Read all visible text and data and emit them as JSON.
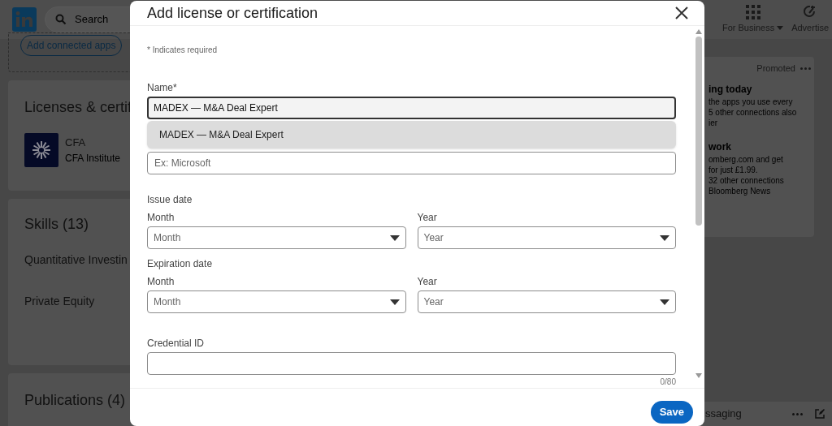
{
  "top_nav": {
    "search_placeholder": "Search",
    "items": [
      {
        "kind": "grid",
        "label": "For Business"
      },
      {
        "kind": "advertise",
        "label": "Advertise"
      }
    ]
  },
  "left_column": {
    "connected_apps_button": "Add connected apps",
    "licenses": {
      "title": "Licenses & certif",
      "items": [
        {
          "name": "CFA",
          "issuer": "CFA Institute"
        }
      ]
    },
    "skills": {
      "title": "Skills (13)",
      "items": [
        "Quantitative Investin",
        "Private Equity"
      ]
    },
    "publications": {
      "title": "Publications (4)"
    }
  },
  "right_column": {
    "promoted": "Promoted",
    "ads": [
      {
        "title": "ing today",
        "lines": [
          "the apps you use every",
          "5 other connections also",
          "ier"
        ]
      },
      {
        "title": "work",
        "lines": [
          "omberg.com and get",
          "for just £1.99.",
          "32 other connections",
          "Bloomberg News"
        ]
      }
    ],
    "messaging": "ssaging"
  },
  "modal": {
    "title": "Add license or certification",
    "required_note": "* Indicates required",
    "name_field": {
      "label": "Name*",
      "value": "MADEX — M&A Deal Expert",
      "suggestions": [
        "MADEX — M&A Deal Expert"
      ]
    },
    "organization_field": {
      "placeholder": "Ex: Microsoft"
    },
    "date_groups": [
      {
        "title": "Issue date",
        "selects": [
          {
            "label": "Month",
            "placeholder": "Month"
          },
          {
            "label": "Year",
            "placeholder": "Year"
          }
        ]
      },
      {
        "title": "Expiration date",
        "selects": [
          {
            "label": "Month",
            "placeholder": "Month"
          },
          {
            "label": "Year",
            "placeholder": "Year"
          }
        ]
      }
    ],
    "credential_field": {
      "label": "Credential ID",
      "counter": "0/80"
    },
    "save_button": "Save"
  }
}
